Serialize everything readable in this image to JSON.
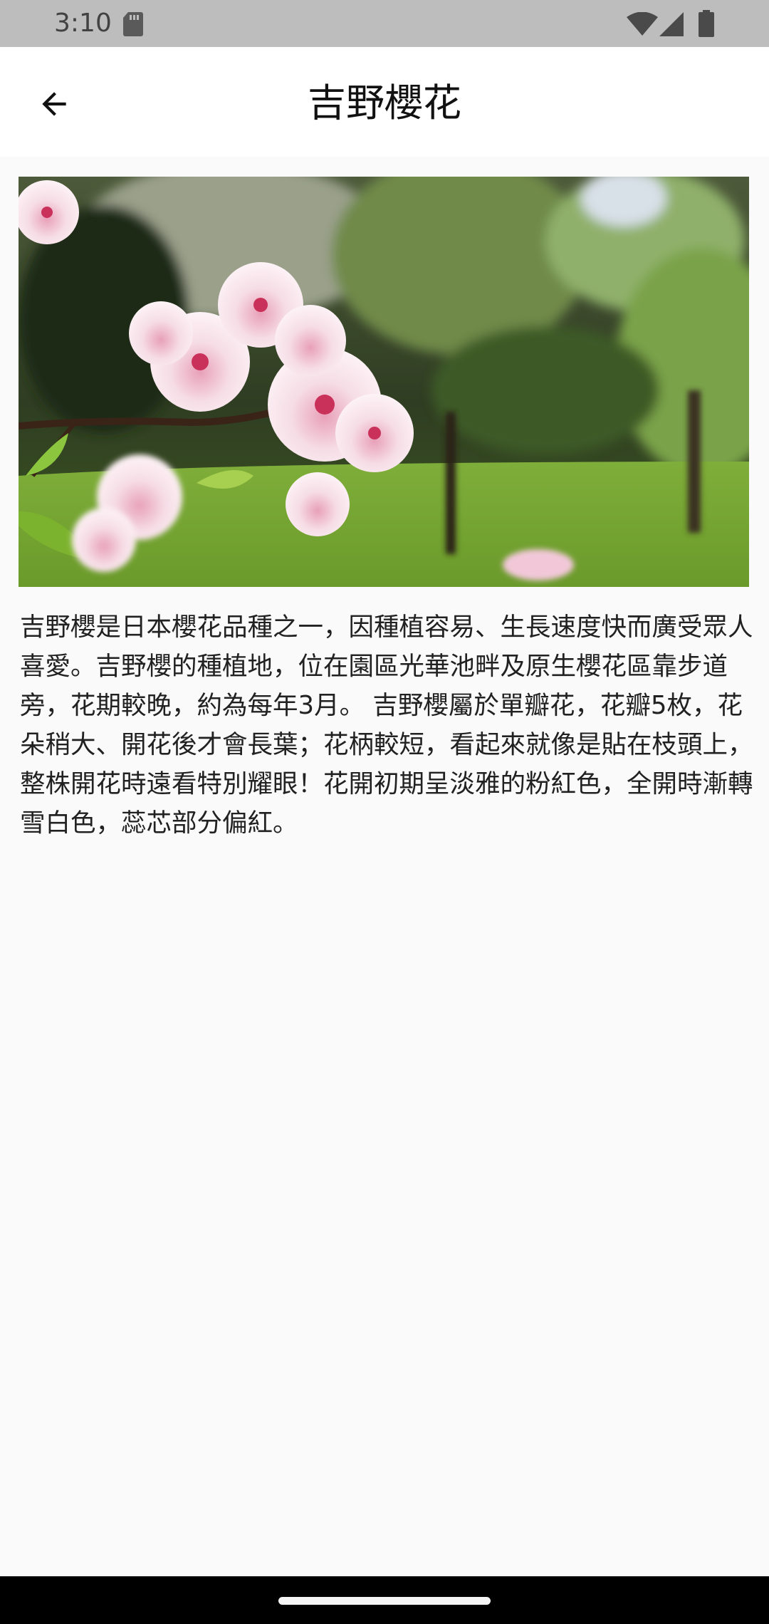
{
  "status_bar": {
    "time": "3:10",
    "icons": [
      "sd-card-icon",
      "wifi-icon",
      "cell-signal-icon",
      "battery-icon"
    ]
  },
  "app_bar": {
    "back_icon": "arrow-back-icon",
    "title": "吉野櫻花"
  },
  "content": {
    "image_subject": "cherry blossom branch in a park",
    "description": "吉野櫻是日本櫻花品種之一，因種植容易、生長速度快而廣受眾人喜愛。吉野櫻的種植地，位在園區光華池畔及原生櫻花區靠步道旁，花期較晚，約為每年3月。 吉野櫻屬於單瓣花，花瓣5枚，花朵稍大、開花後才會長葉；花柄較短，看起來就像是貼在枝頭上，整株開花時遠看特別耀眼！花開初期呈淡雅的粉紅色，全開時漸轉雪白色，蕊芯部分偏紅。"
  },
  "colors": {
    "status_bar": "#bdbdbd",
    "app_bar": "#ffffff",
    "background": "#fafafa",
    "nav_bar": "#000000"
  }
}
